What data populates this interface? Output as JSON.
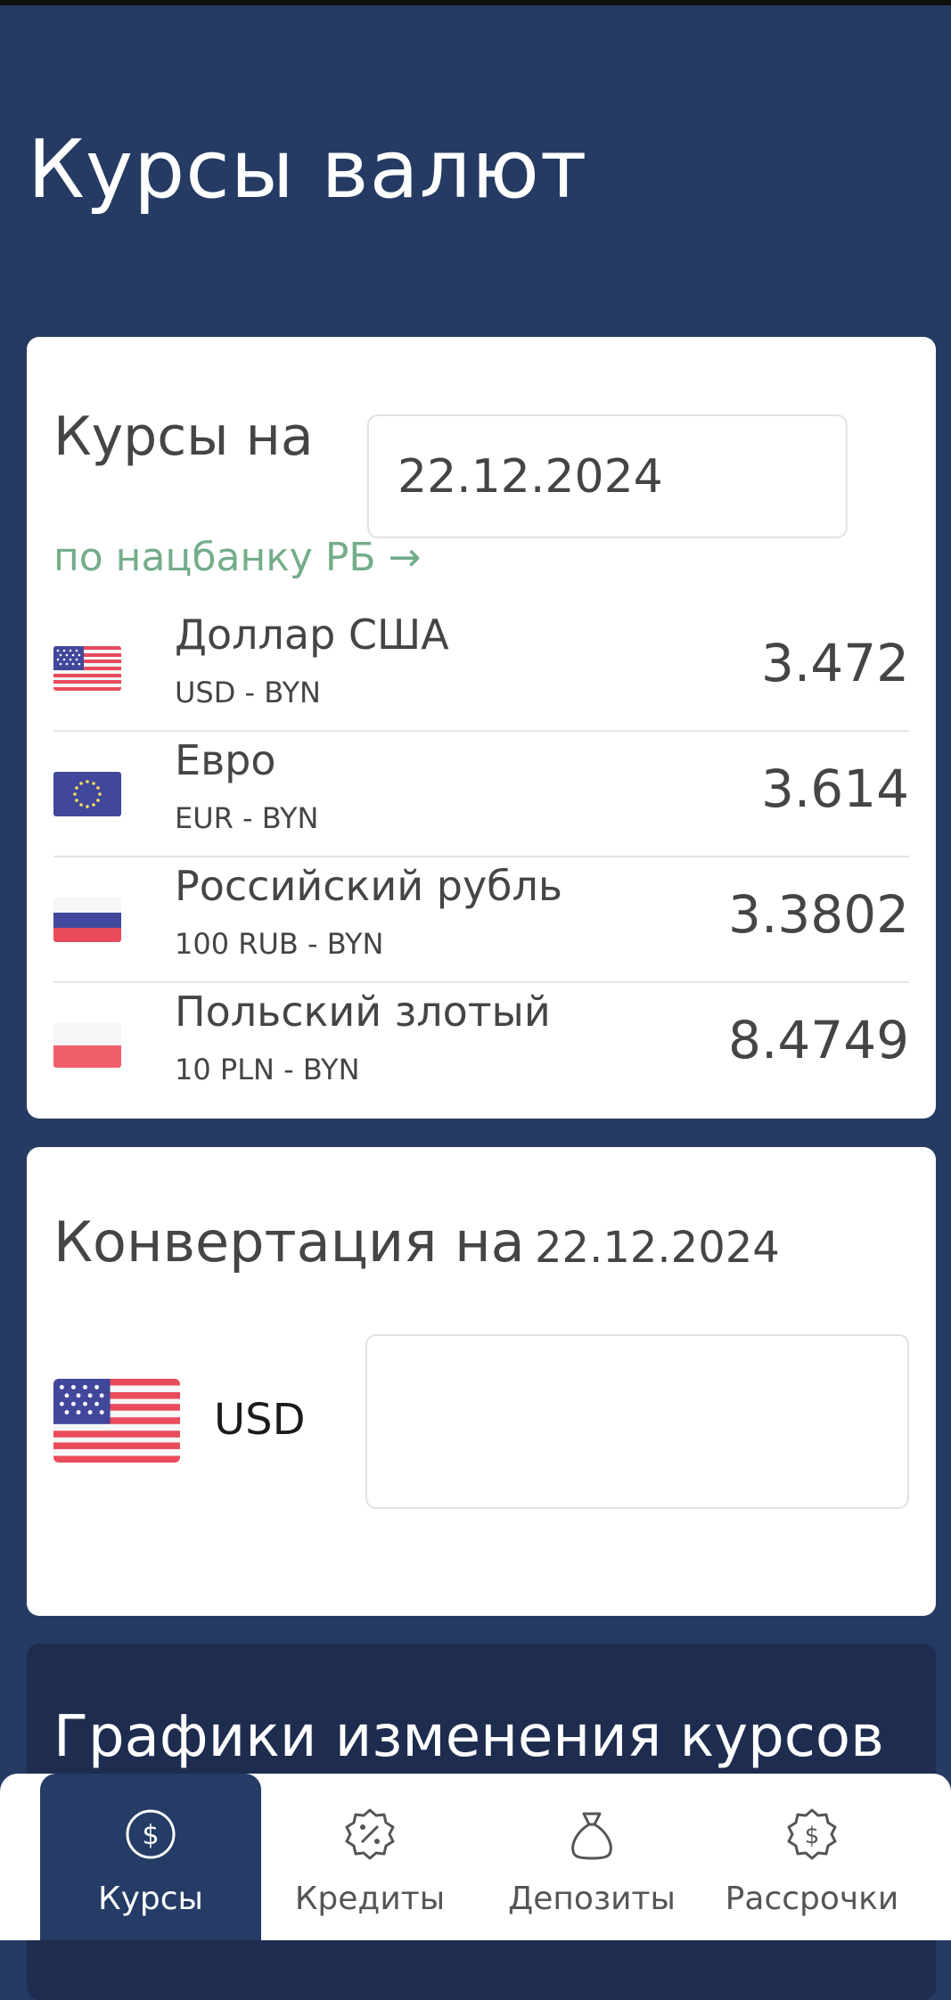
{
  "header": {
    "title": "Курсы валют"
  },
  "rates": {
    "label": "Курсы на",
    "date": "22.12.2024",
    "source_link": "по нацбанку РБ →",
    "items": [
      {
        "flag": "us-flag-icon",
        "name": "Доллар США",
        "pair": "USD - BYN",
        "value": "3.472"
      },
      {
        "flag": "eu-flag-icon",
        "name": "Евро",
        "pair": "EUR - BYN",
        "value": "3.614"
      },
      {
        "flag": "ru-flag-icon",
        "name": "Российский рубль",
        "pair": "100 RUB - BYN",
        "value": "3.3802"
      },
      {
        "flag": "pl-flag-icon",
        "name": "Польский злотый",
        "pair": "10 PLN - BYN",
        "value": "8.4749"
      }
    ]
  },
  "converter": {
    "title": "Конвертация на",
    "date": "22.12.2024",
    "currency_code": "USD",
    "amount": ""
  },
  "charts": {
    "title": "Графики изменения курсов"
  },
  "nav": {
    "items": [
      {
        "label": "Курсы",
        "icon": "dollar-coin-icon",
        "active": true
      },
      {
        "label": "Кредиты",
        "icon": "percent-badge-icon",
        "active": false
      },
      {
        "label": "Депозиты",
        "icon": "money-bag-icon",
        "active": false
      },
      {
        "label": "Рассрочки",
        "icon": "dollar-badge-icon",
        "active": false
      }
    ]
  },
  "colors": {
    "header_bg": "#253b63",
    "link_green": "#74ad8a",
    "nav_active_bg": "#243c66",
    "charts_bg": "#1e2d4f"
  }
}
